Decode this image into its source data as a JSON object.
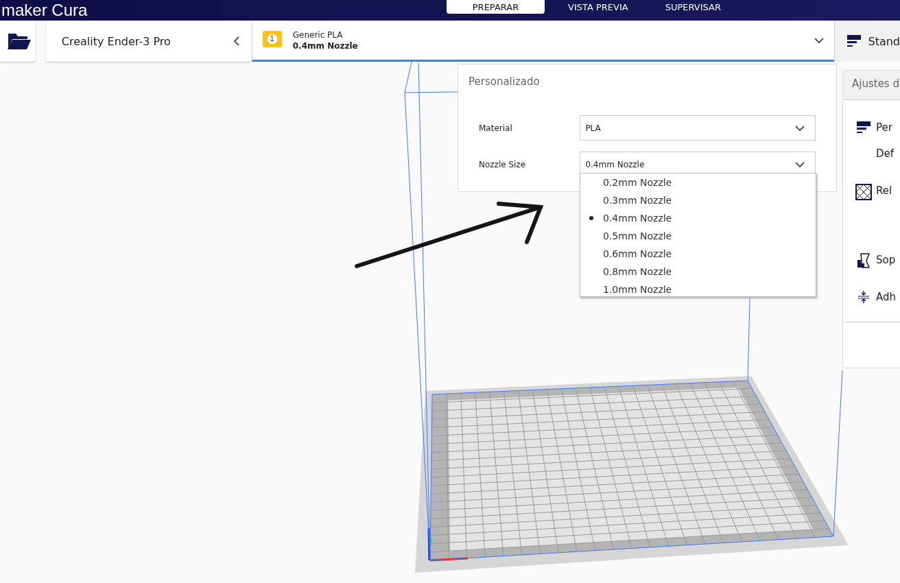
{
  "app": {
    "title": "maker Cura"
  },
  "stages": [
    {
      "label": "PREPARAR",
      "selected": true
    },
    {
      "label": "VISTA PREVIA",
      "selected": false
    },
    {
      "label": "SUPERVISAR",
      "selected": false
    }
  ],
  "printer": {
    "name": "Creality Ender-3 Pro"
  },
  "extruder": {
    "number": "1",
    "material": "Generic PLA",
    "nozzle": "0.4mm Nozzle"
  },
  "profile": {
    "label": "Stand"
  },
  "popup": {
    "title": "Personalizado",
    "fields": [
      {
        "label": "Material",
        "value": "PLA"
      },
      {
        "label": "Nozzle Size",
        "value": "0.4mm Nozzle"
      }
    ],
    "options": [
      {
        "label": "0.2mm Nozzle",
        "selected": false
      },
      {
        "label": "0.3mm Nozzle",
        "selected": false
      },
      {
        "label": "0.4mm Nozzle",
        "selected": true
      },
      {
        "label": "0.5mm Nozzle",
        "selected": false
      },
      {
        "label": "0.6mm Nozzle",
        "selected": false
      },
      {
        "label": "0.8mm Nozzle",
        "selected": false
      },
      {
        "label": "1.0mm Nozzle",
        "selected": false
      }
    ]
  },
  "settings": {
    "title": "Ajustes d",
    "items": [
      {
        "kind": "profile",
        "label": "Per"
      },
      {
        "kind": "plain",
        "label": "Def"
      },
      {
        "kind": "infill",
        "label": "Rel"
      },
      {
        "kind": "support",
        "label": "Sop"
      },
      {
        "kind": "adhesion",
        "label": "Adh"
      }
    ]
  }
}
